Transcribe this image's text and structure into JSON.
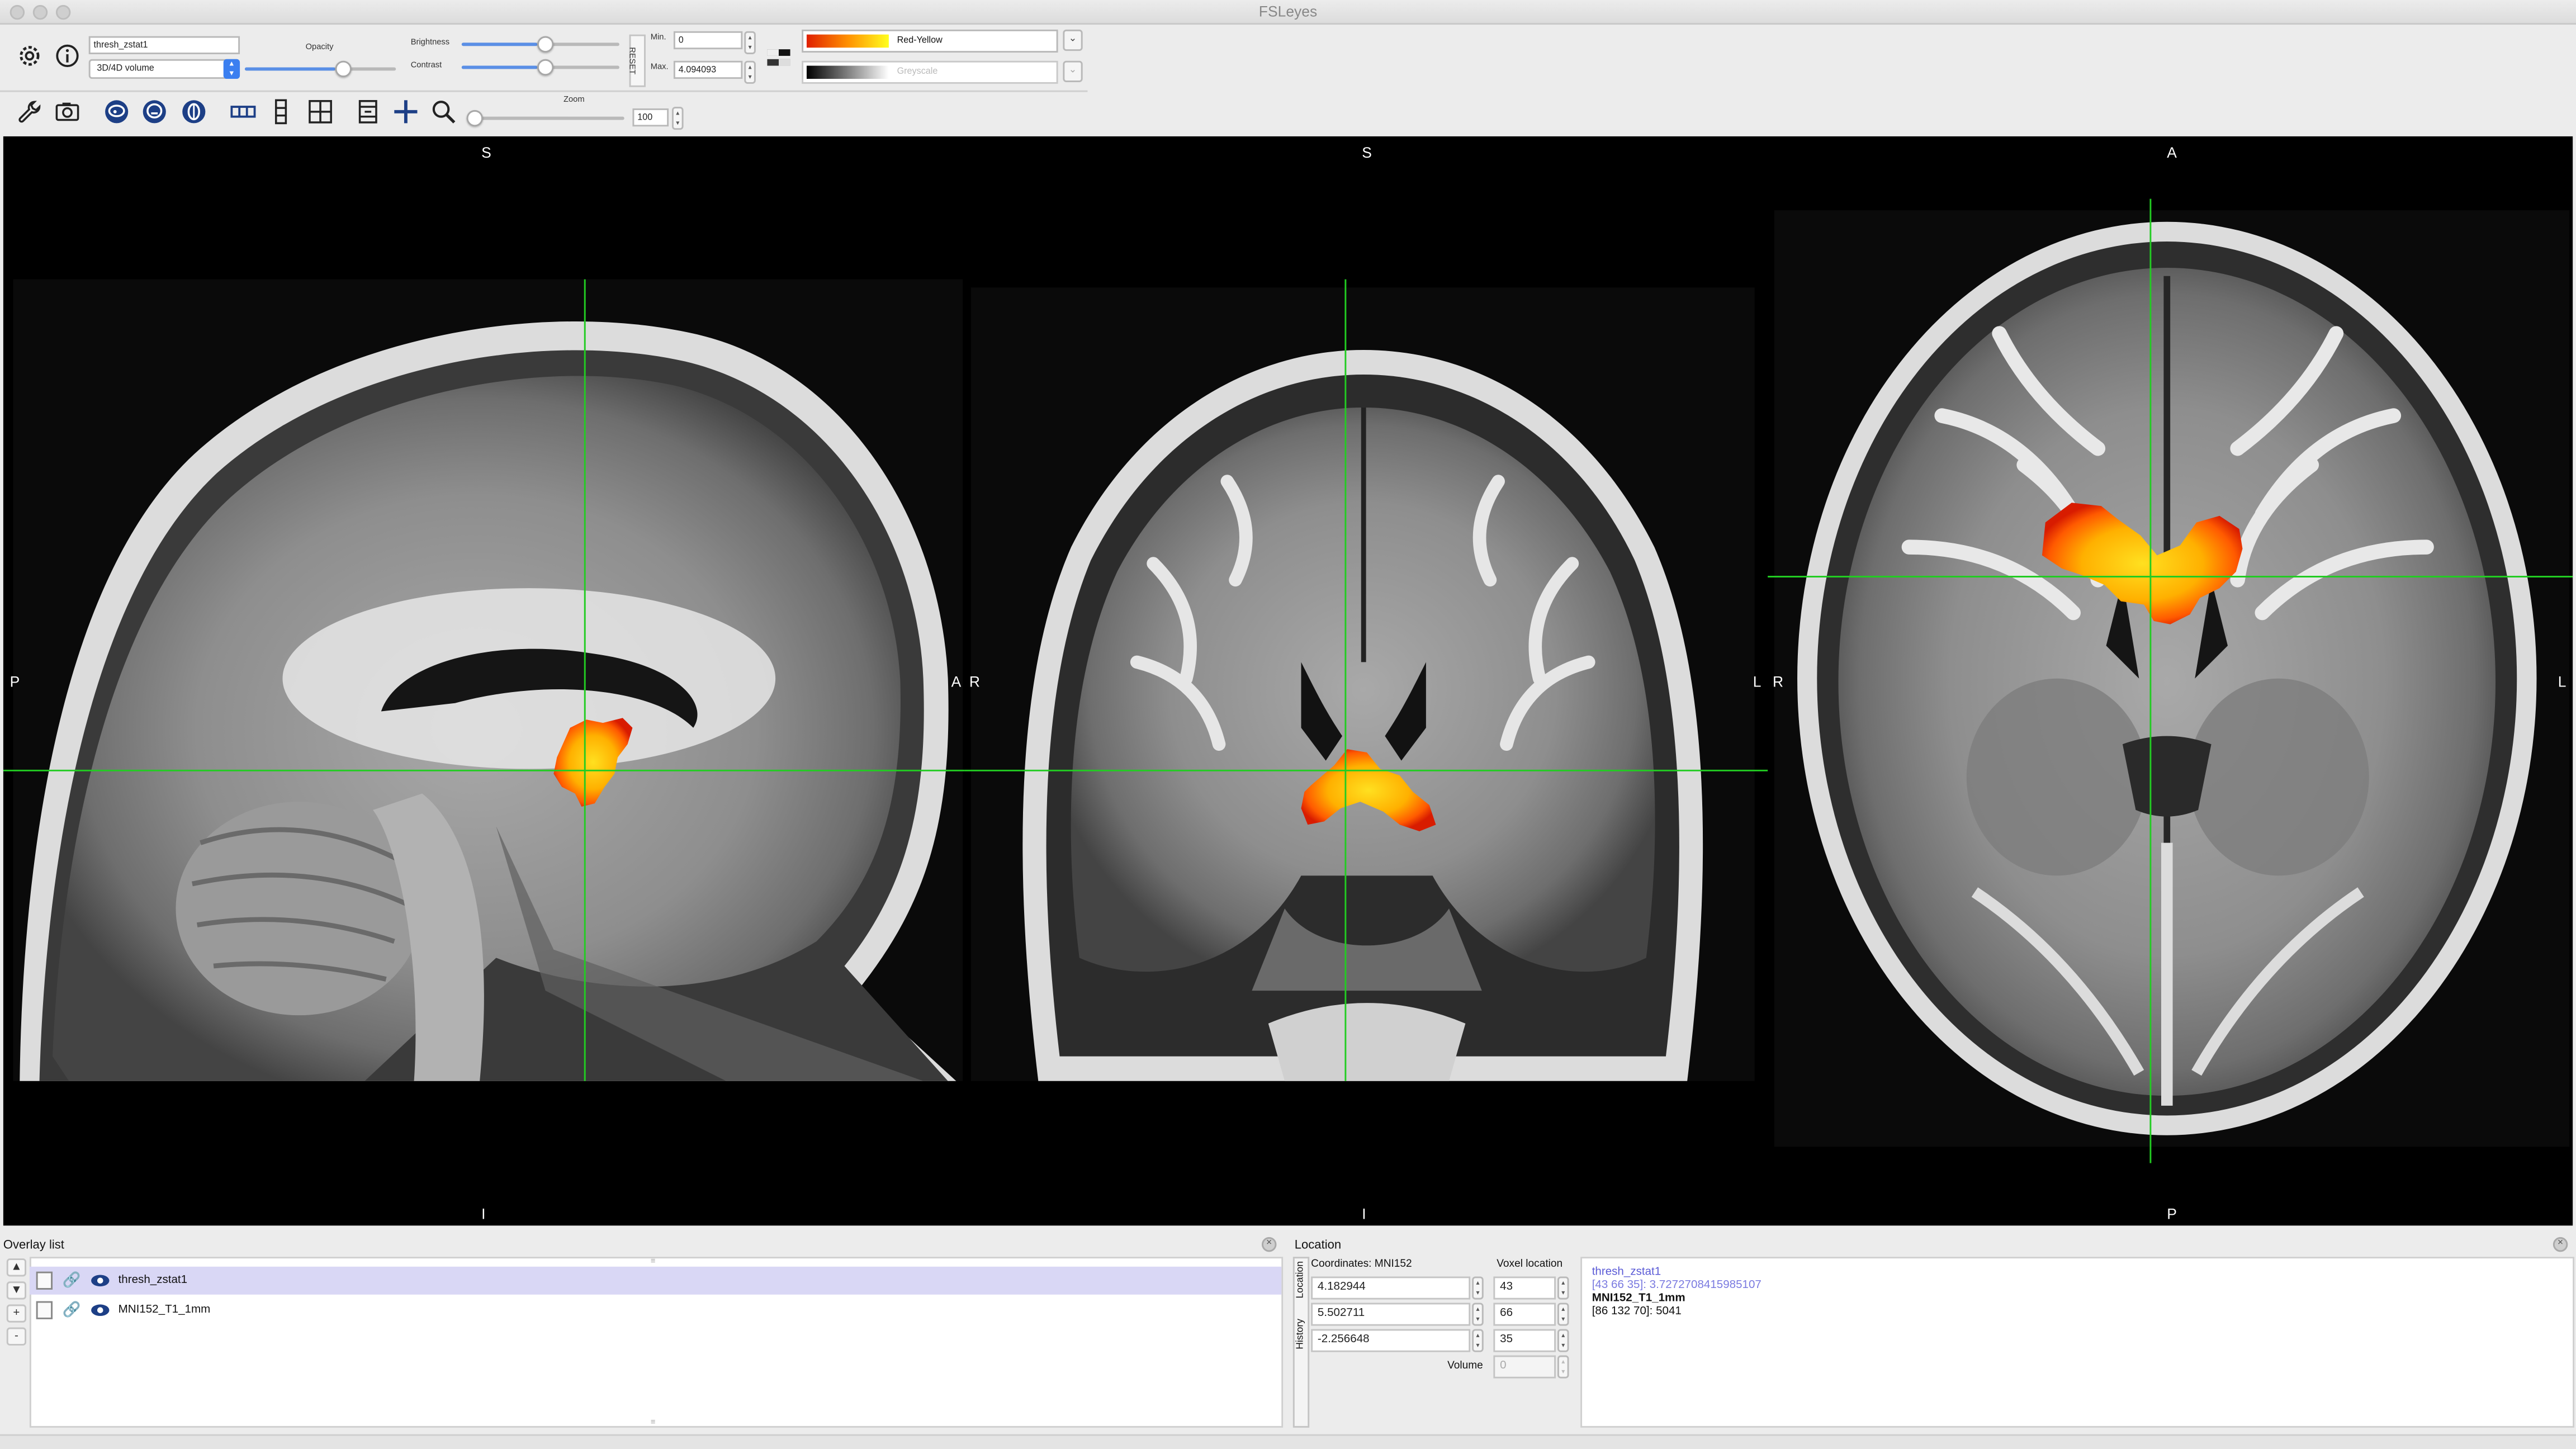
{
  "window": {
    "title": "FSLeyes"
  },
  "toolbar": {
    "overlay_name": "thresh_zstat1",
    "overlay_type": "3D/4D volume",
    "opacity_label": "Opacity",
    "brightness_label": "Brightness",
    "contrast_label": "Contrast",
    "reset_label": "RESET",
    "min_label": "Min.",
    "min_value": "0",
    "max_label": "Max.",
    "max_value": "4.094093",
    "cmap_primary": "Red-Yellow",
    "cmap_secondary": "Greyscale",
    "zoom_label": "Zoom",
    "zoom_value": "100",
    "opacity_level": 0.6,
    "brightness_level": 0.5,
    "contrast_level": 0.5,
    "zoom_level": 0.0
  },
  "views": {
    "sagittal": {
      "top": "S",
      "bottom": "I",
      "left": "P",
      "right": "A"
    },
    "coronal": {
      "top": "S",
      "bottom": "I",
      "left": "R",
      "right": "L"
    },
    "axial": {
      "top": "A",
      "bottom": "P",
      "left": "R",
      "right": "L"
    }
  },
  "overlay_list": {
    "title": "Overlay list",
    "items": [
      {
        "name": "thresh_zstat1",
        "selected": true
      },
      {
        "name": "MNI152_T1_1mm",
        "selected": false
      }
    ],
    "buttons": [
      "▲",
      "▼",
      "+",
      "-"
    ]
  },
  "location": {
    "title": "Location",
    "tabs": [
      "Location",
      "History"
    ],
    "coords_label": "Coordinates: MNI152",
    "voxel_label": "Voxel location",
    "x": "4.182944",
    "y": "5.502711",
    "z": "-2.256648",
    "vx": "43",
    "vy": "66",
    "vz": "35",
    "volume_label": "Volume",
    "volume_value": "0",
    "info": {
      "overlay1_name": "thresh_zstat1",
      "overlay1_value": "[43 66 35]: 3.7272708415985107",
      "overlay2_name": "MNI152_T1_1mm",
      "overlay2_value": "[86 132 70]: 5041"
    }
  },
  "colors": {
    "cursor": "#22cc22",
    "selected_row": "#d9d7f5",
    "overlay1_text": "#5a5ad6"
  }
}
